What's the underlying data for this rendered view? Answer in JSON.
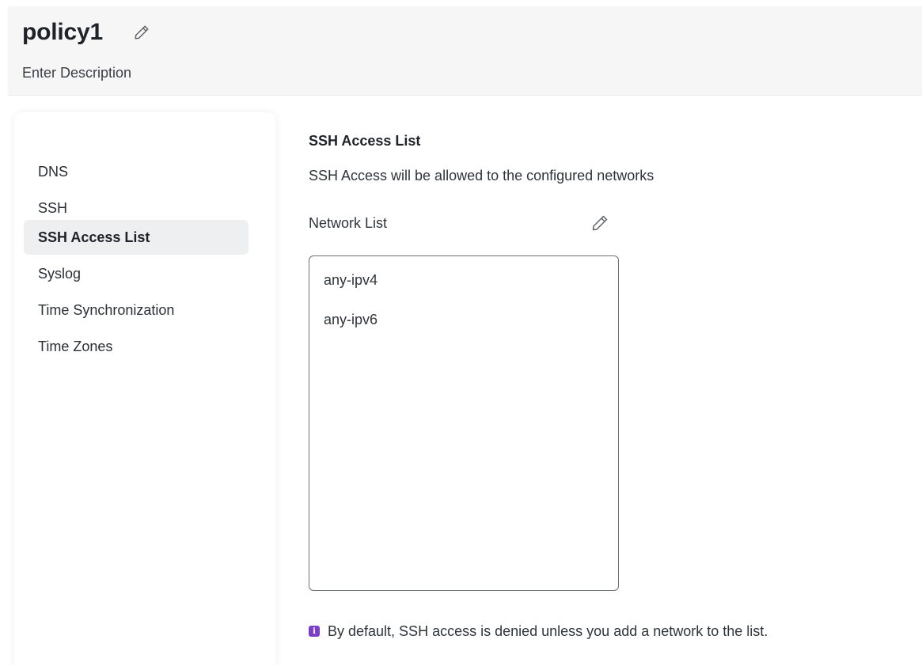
{
  "header": {
    "title": "policy1",
    "description": "Enter Description",
    "edit_icon": "pencil-icon"
  },
  "sidebar": {
    "items": [
      {
        "label": "DNS",
        "active": false
      },
      {
        "label": "SSH",
        "active": false
      },
      {
        "label": "SSH Access List",
        "active": true
      },
      {
        "label": "Syslog",
        "active": false
      },
      {
        "label": "Time Synchronization",
        "active": false
      },
      {
        "label": "Time Zones",
        "active": false
      }
    ]
  },
  "content": {
    "section_title": "SSH Access List",
    "section_description": "SSH Access will be allowed to the configured networks",
    "network_list_label": "Network List",
    "network_list_edit_icon": "pencil-icon",
    "networks": [
      "any-ipv4",
      "any-ipv6"
    ],
    "info_icon": "info-icon",
    "info_text": "By default, SSH access is denied unless you add a network to the list."
  },
  "colors": {
    "header_background": "#f6f6f6",
    "active_nav_background": "#eeeff1",
    "info_accent": "#7b3fc6",
    "text_primary": "#1f2329"
  }
}
